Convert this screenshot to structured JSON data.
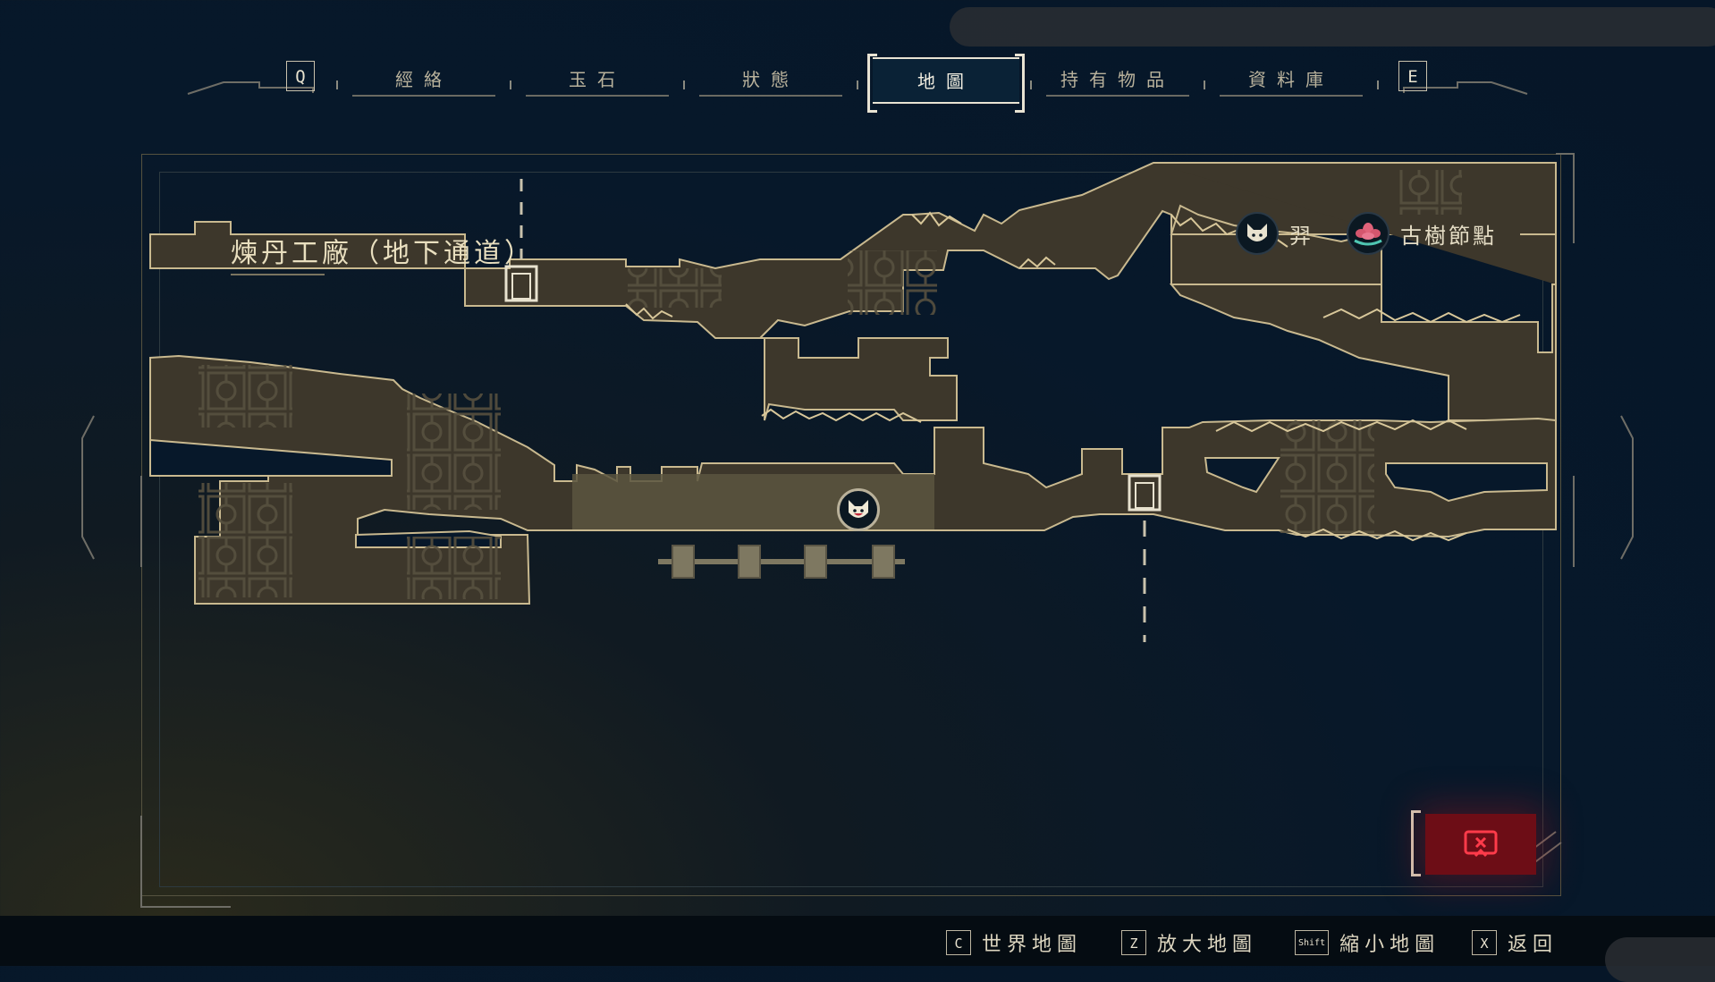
{
  "tabs": {
    "left_key": "Q",
    "right_key": "E",
    "items": [
      {
        "label": "經絡"
      },
      {
        "label": "玉石"
      },
      {
        "label": "狀態"
      },
      {
        "label": "地圖"
      },
      {
        "label": "持有物品"
      },
      {
        "label": "資料庫"
      }
    ],
    "active_index": 3
  },
  "map": {
    "area_name": "煉丹工廠（地下通道）",
    "legend": [
      {
        "icon": "cat-face-icon",
        "label": "羿"
      },
      {
        "icon": "lotus-node-icon",
        "label": "古樹節點"
      }
    ],
    "colors": {
      "room_fill": "#3f392d",
      "room_stroke": "#c9b98f",
      "grass": "#d8c79a",
      "close_button": "#6d0d16"
    }
  },
  "controls": [
    {
      "key": "C",
      "label": "世界地圖"
    },
    {
      "key": "Z",
      "label": "放大地圖"
    },
    {
      "key": "Shift",
      "label": "縮小地圖"
    },
    {
      "key": "X",
      "label": "返回"
    }
  ]
}
